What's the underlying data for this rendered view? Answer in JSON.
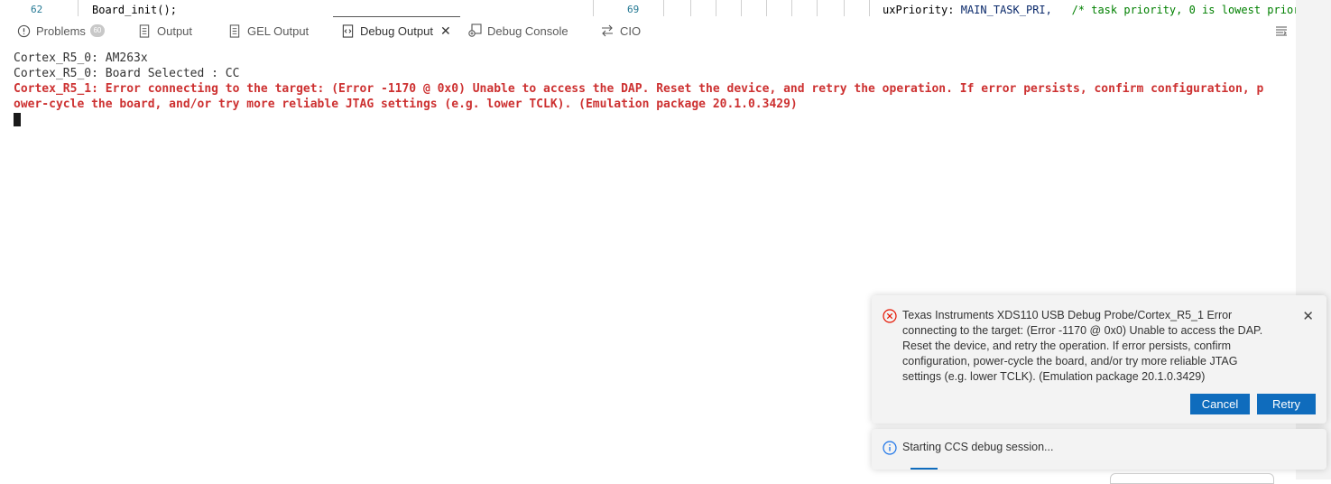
{
  "editor": {
    "left_line_number": "62",
    "left_code": "Board_init();",
    "right_line_number": "69",
    "right_code_name": "uxPriority:",
    "right_code_value": "MAIN_TASK_PRI,",
    "right_code_comment": "/* task priority, 0 is lowest priori"
  },
  "panel": {
    "tabs": [
      {
        "label": "Problems",
        "icon": "problems-icon",
        "badge": "60"
      },
      {
        "label": "Output",
        "icon": "output-icon"
      },
      {
        "label": "GEL Output",
        "icon": "gel-output-icon"
      },
      {
        "label": "Debug Output",
        "icon": "debug-output-icon",
        "active": true
      },
      {
        "label": "Debug Console",
        "icon": "debug-console-icon"
      },
      {
        "label": "CIO",
        "icon": "cio-icon"
      }
    ],
    "close_glyph": "✕"
  },
  "output": {
    "line1": "Cortex_R5_0: AM263x",
    "line2": "Cortex_R5_0: Board Selected : CC",
    "error_line1": "Cortex_R5_1: Error connecting to the target: (Error -1170 @ 0x0) Unable to access the DAP. Reset the device, and retry the operation. If error persists, confirm configuration, p",
    "error_line2": "ower-cycle the board, and/or try more reliable JTAG settings (e.g. lower TCLK). (Emulation package 20.1.0.3429)"
  },
  "notifications": {
    "error": {
      "message": "Texas Instruments XDS110 USB Debug Probe/Cortex_R5_1 Error connecting to the target: (Error -1170 @ 0x0) Unable to access the DAP. Reset the device, and retry the operation. If error persists, confirm configuration, power-cycle the board, and/or try more reliable JTAG settings (e.g. lower TCLK). (Emulation package 20.1.0.3429)",
      "cancel_label": "Cancel",
      "retry_label": "Retry",
      "close_glyph": "✕"
    },
    "info": {
      "message": "Starting CCS debug session..."
    }
  },
  "colors": {
    "error_red": "#cd3131",
    "button_blue": "#0f6cbd",
    "info_blue": "#1a73e8"
  }
}
